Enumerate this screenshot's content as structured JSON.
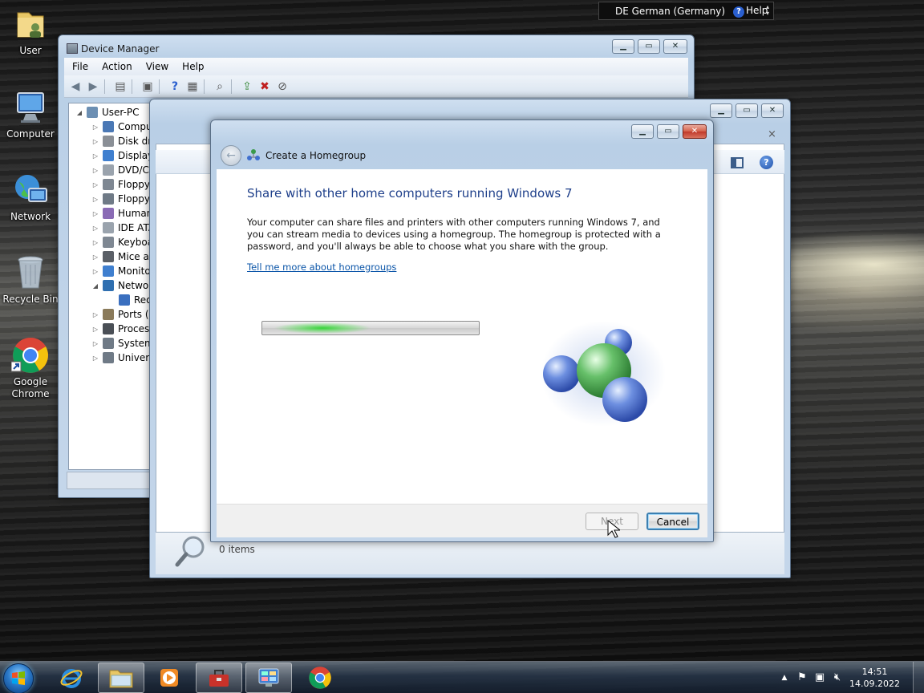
{
  "language_bar": {
    "language": "DE German (Germany)",
    "help_label": "Help"
  },
  "desktop_icons": [
    {
      "label": "User"
    },
    {
      "label": "Computer"
    },
    {
      "label": "Network"
    },
    {
      "label": "Recycle Bin"
    },
    {
      "label": "Google Chrome"
    }
  ],
  "device_manager": {
    "title": "Device Manager",
    "menu": [
      "File",
      "Action",
      "View",
      "Help"
    ],
    "tree_root": "User-PC",
    "tree_items": [
      "Computer",
      "Disk drives",
      "Display adapters",
      "DVD/CD-ROM drives",
      "Floppy disk drives",
      "Floppy drive controllers",
      "Human Interface Devices",
      "IDE ATA/ATAPI controllers",
      "Keyboards",
      "Mice and other pointing devices",
      "Monitors",
      "Network adapters",
      "Red Hat VirtIO Ethernet Adapter",
      "Ports (COM & LPT)",
      "Processors",
      "System devices",
      "Universal Serial Bus controllers"
    ]
  },
  "explorer": {
    "items_count": "0 items"
  },
  "wizard": {
    "title": "Create a Homegroup",
    "heading": "Share with other home computers running Windows 7",
    "description": "Your computer can share files and printers with other computers running Windows 7, and you can stream media to devices using a homegroup. The homegroup is protected with a password, and you'll always be able to choose what you share with the group.",
    "link": "Tell me more about homegroups",
    "next_label": "Next",
    "cancel_label": "Cancel",
    "progress_indeterminate": true
  },
  "taskbar": {
    "clock_time": "14:51",
    "clock_date": "14.09.2022",
    "pinned": [
      "Internet Explorer",
      "Windows Explorer",
      "Windows Media Player",
      "Toolbox",
      "Control Panel",
      "Google Chrome"
    ]
  },
  "colors": {
    "link": "#0b55a8",
    "heading": "#1e3f8a",
    "progress_glow": "#37d43a"
  }
}
